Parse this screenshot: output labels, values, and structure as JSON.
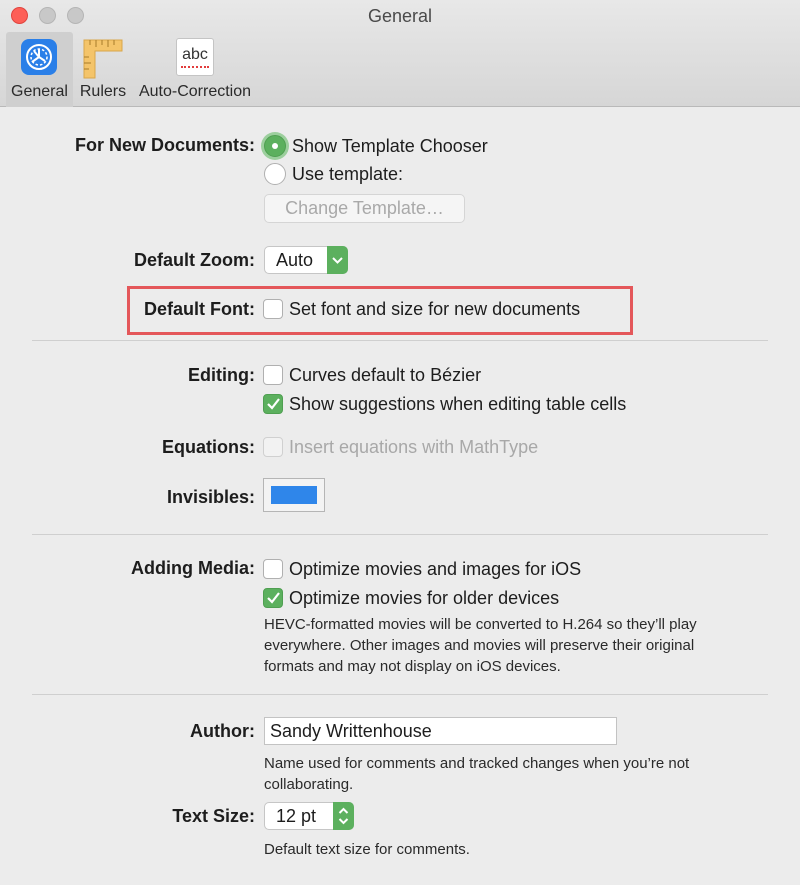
{
  "window": {
    "title": "General"
  },
  "toolbar": {
    "items": [
      {
        "label": "General",
        "icon": "general-gear-icon",
        "selected": true
      },
      {
        "label": "Rulers",
        "icon": "ruler-icon",
        "selected": false
      },
      {
        "label": "Auto-Correction",
        "icon": "abc-spelling-icon",
        "selected": false
      }
    ],
    "abc_icon_text": "abc"
  },
  "new_documents": {
    "label": "For New Documents:",
    "show_template_chooser": "Show Template Chooser",
    "use_template": "Use template:",
    "change_template_button": "Change Template…",
    "selected": "show_template_chooser"
  },
  "default_zoom": {
    "label": "Default Zoom:",
    "value": "Auto"
  },
  "default_font": {
    "label": "Default Font:",
    "option": "Set font and size for new documents",
    "checked": false
  },
  "editing": {
    "label": "Editing:",
    "curves_bezier": {
      "text": "Curves default to Bézier",
      "checked": false
    },
    "show_suggestions": {
      "text": "Show suggestions when editing table cells",
      "checked": true
    }
  },
  "equations": {
    "label": "Equations:",
    "option": "Insert equations with MathType",
    "checked": false,
    "enabled": false
  },
  "invisibles": {
    "label": "Invisibles:",
    "color": "#2f86ea"
  },
  "adding_media": {
    "label": "Adding Media:",
    "optimize_ios": {
      "text": "Optimize movies and images for iOS",
      "checked": false
    },
    "optimize_older": {
      "text": "Optimize movies for older devices",
      "checked": true
    },
    "help_line1": "HEVC-formatted movies will be converted to H.264 so they’ll play",
    "help_line2": "everywhere. Other images and movies will preserve their original",
    "help_line3": "formats and may not display on iOS devices."
  },
  "author": {
    "label": "Author:",
    "value": "Sandy Writtenhouse",
    "help_line1": "Name used for comments and tracked changes when you’re not",
    "help_line2": "collaborating."
  },
  "text_size": {
    "label": "Text Size:",
    "value": "12 pt",
    "help": "Default text size for comments."
  },
  "colors": {
    "accent_green": "#5cb05e",
    "highlight_red": "#e4575a"
  }
}
